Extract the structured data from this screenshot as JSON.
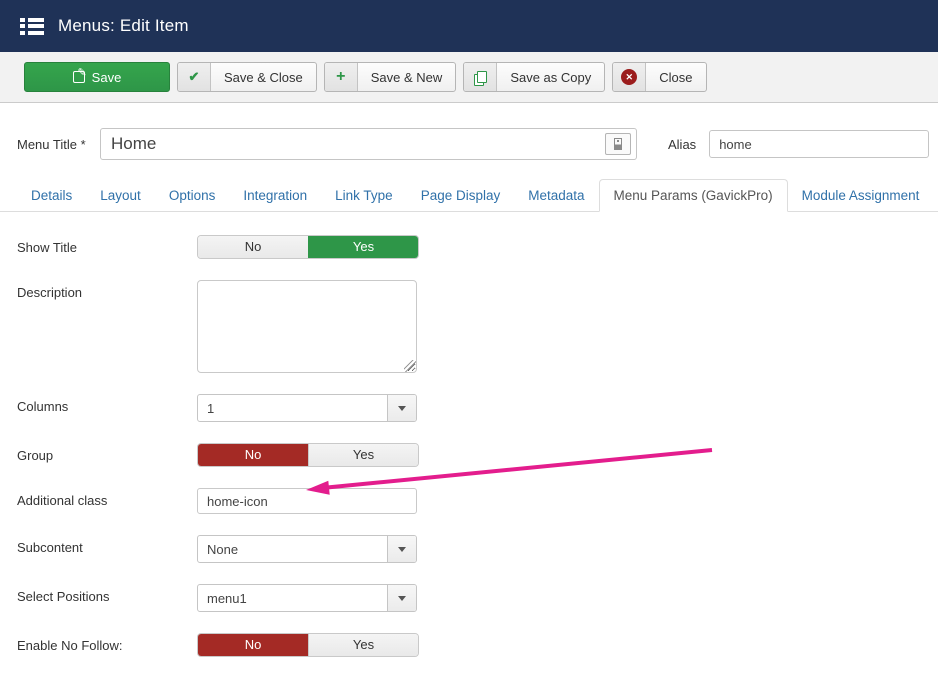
{
  "header": {
    "title": "Menus: Edit Item"
  },
  "toolbar": {
    "save_label": "Save",
    "save_close_label": "Save & Close",
    "save_new_label": "Save & New",
    "save_copy_label": "Save as Copy",
    "close_label": "Close"
  },
  "title_row": {
    "menu_title_label": "Menu Title *",
    "menu_title_value": "Home",
    "alias_label": "Alias",
    "alias_value": "home"
  },
  "tabs": [
    {
      "label": "Details"
    },
    {
      "label": "Layout"
    },
    {
      "label": "Options"
    },
    {
      "label": "Integration"
    },
    {
      "label": "Link Type"
    },
    {
      "label": "Page Display"
    },
    {
      "label": "Metadata"
    },
    {
      "label": "Menu Params (GavickPro)",
      "active": true
    },
    {
      "label": "Module Assignment"
    }
  ],
  "fields": [
    {
      "label": "Show Title",
      "type": "toggle",
      "options": [
        "No",
        "Yes"
      ],
      "selected": "Yes",
      "selected_color": "#2e9648"
    },
    {
      "label": "Description",
      "type": "textarea",
      "value": ""
    },
    {
      "label": "Columns",
      "type": "select",
      "value": "1"
    },
    {
      "label": "Group",
      "type": "toggle",
      "options": [
        "No",
        "Yes"
      ],
      "selected": "No",
      "selected_color": "#a42a25"
    },
    {
      "label": "Additional class",
      "type": "text",
      "value": "home-icon"
    },
    {
      "label": "Subcontent",
      "type": "select",
      "value": "None"
    },
    {
      "label": "Select Positions",
      "type": "select",
      "value": "menu1"
    },
    {
      "label": "Enable No Follow:",
      "type": "toggle",
      "options": [
        "No",
        "Yes"
      ],
      "selected": "No",
      "selected_color": "#a42a25"
    }
  ],
  "annotation": {
    "arrow_points_to": "Additional class input",
    "arrow_color": "#e31d8d"
  },
  "icons": {
    "menus-icon": "list-bars",
    "save-icon": "pencil-square",
    "check-icon": "checkmark",
    "plus-icon": "plus",
    "copy-icon": "overlapping-pages",
    "close-icon": "circle-x",
    "modal-field-icon": "input-box",
    "chevron-down-icon": "caret-down"
  },
  "colors": {
    "header_bg": "#1f3257",
    "toolbar_bg": "#f2f2f2",
    "accent_green": "#2e9648",
    "accent_red": "#a42a25",
    "link_blue": "#3071a9",
    "arrow_pink": "#e31d8d"
  }
}
